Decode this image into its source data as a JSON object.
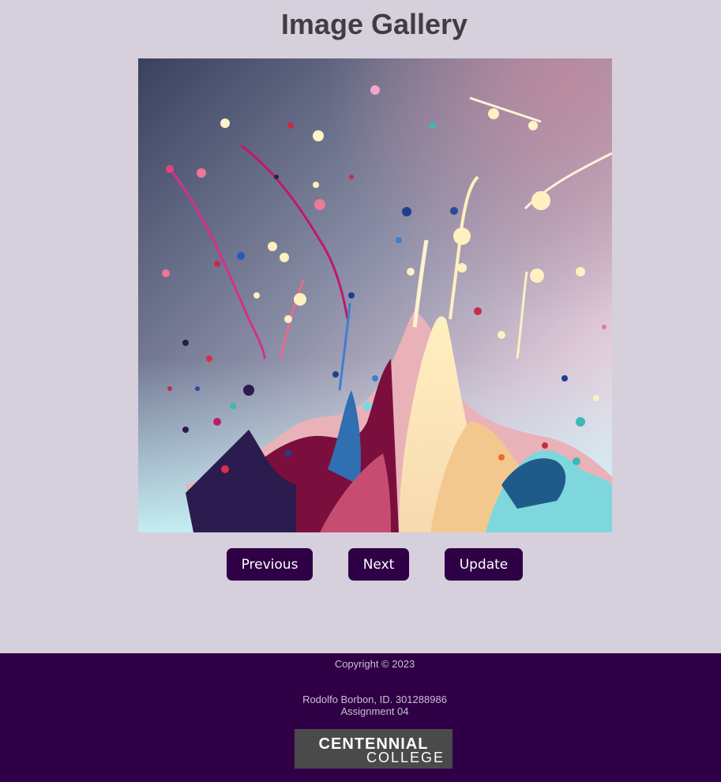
{
  "page": {
    "title": "Image Gallery"
  },
  "gallery": {
    "image_description": "colorful paint splash"
  },
  "controls": {
    "previous_label": "Previous",
    "next_label": "Next",
    "update_label": "Update"
  },
  "footer": {
    "copyright": "Copyright © 2023",
    "author_line1": "Rodolfo Borbon, ID. 301288986",
    "author_line2": "Assignment 04",
    "logo_line1": "CENTENNIAL",
    "logo_line2": "COLLEGE"
  },
  "colors": {
    "background": "#d6cfdc",
    "accent": "#2f0045",
    "title_text": "#423d44",
    "footer_text": "#c8bfcf",
    "logo_background": "#4a4a4a"
  }
}
